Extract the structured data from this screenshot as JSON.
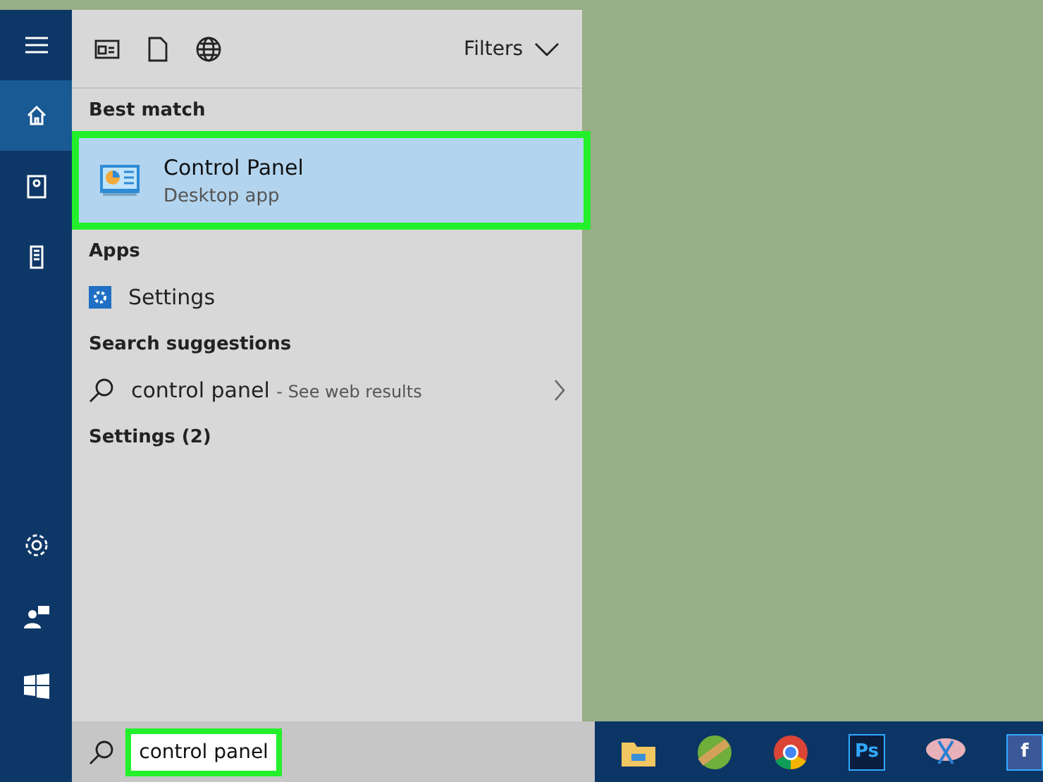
{
  "top_bar": {
    "filters_label": "Filters"
  },
  "rail": {
    "items": [
      {
        "kind": "menu",
        "selected": false
      },
      {
        "kind": "home",
        "selected": true
      },
      {
        "kind": "notebook",
        "selected": false
      },
      {
        "kind": "device",
        "selected": false
      }
    ],
    "bottom_items": [
      {
        "kind": "settings"
      },
      {
        "kind": "feedback"
      },
      {
        "kind": "start"
      }
    ]
  },
  "best_match": {
    "heading": "Best match",
    "title": "Control Panel",
    "subtitle": "Desktop app",
    "highlighted": true
  },
  "apps": {
    "heading": "Apps",
    "items": [
      {
        "label": "Settings"
      }
    ]
  },
  "suggestions": {
    "heading": "Search suggestions",
    "items": [
      {
        "query": "control panel",
        "hint": "- See web results"
      }
    ]
  },
  "settings_group": {
    "heading": "Settings (2)"
  },
  "search_box": {
    "value": "control panel",
    "highlighted": true
  },
  "taskbar": [
    {
      "kind": "folder"
    },
    {
      "kind": "game"
    },
    {
      "kind": "chrome"
    },
    {
      "kind": "photoshop",
      "label": "Ps"
    },
    {
      "kind": "snip"
    },
    {
      "kind": "facebook",
      "label": "f"
    }
  ]
}
